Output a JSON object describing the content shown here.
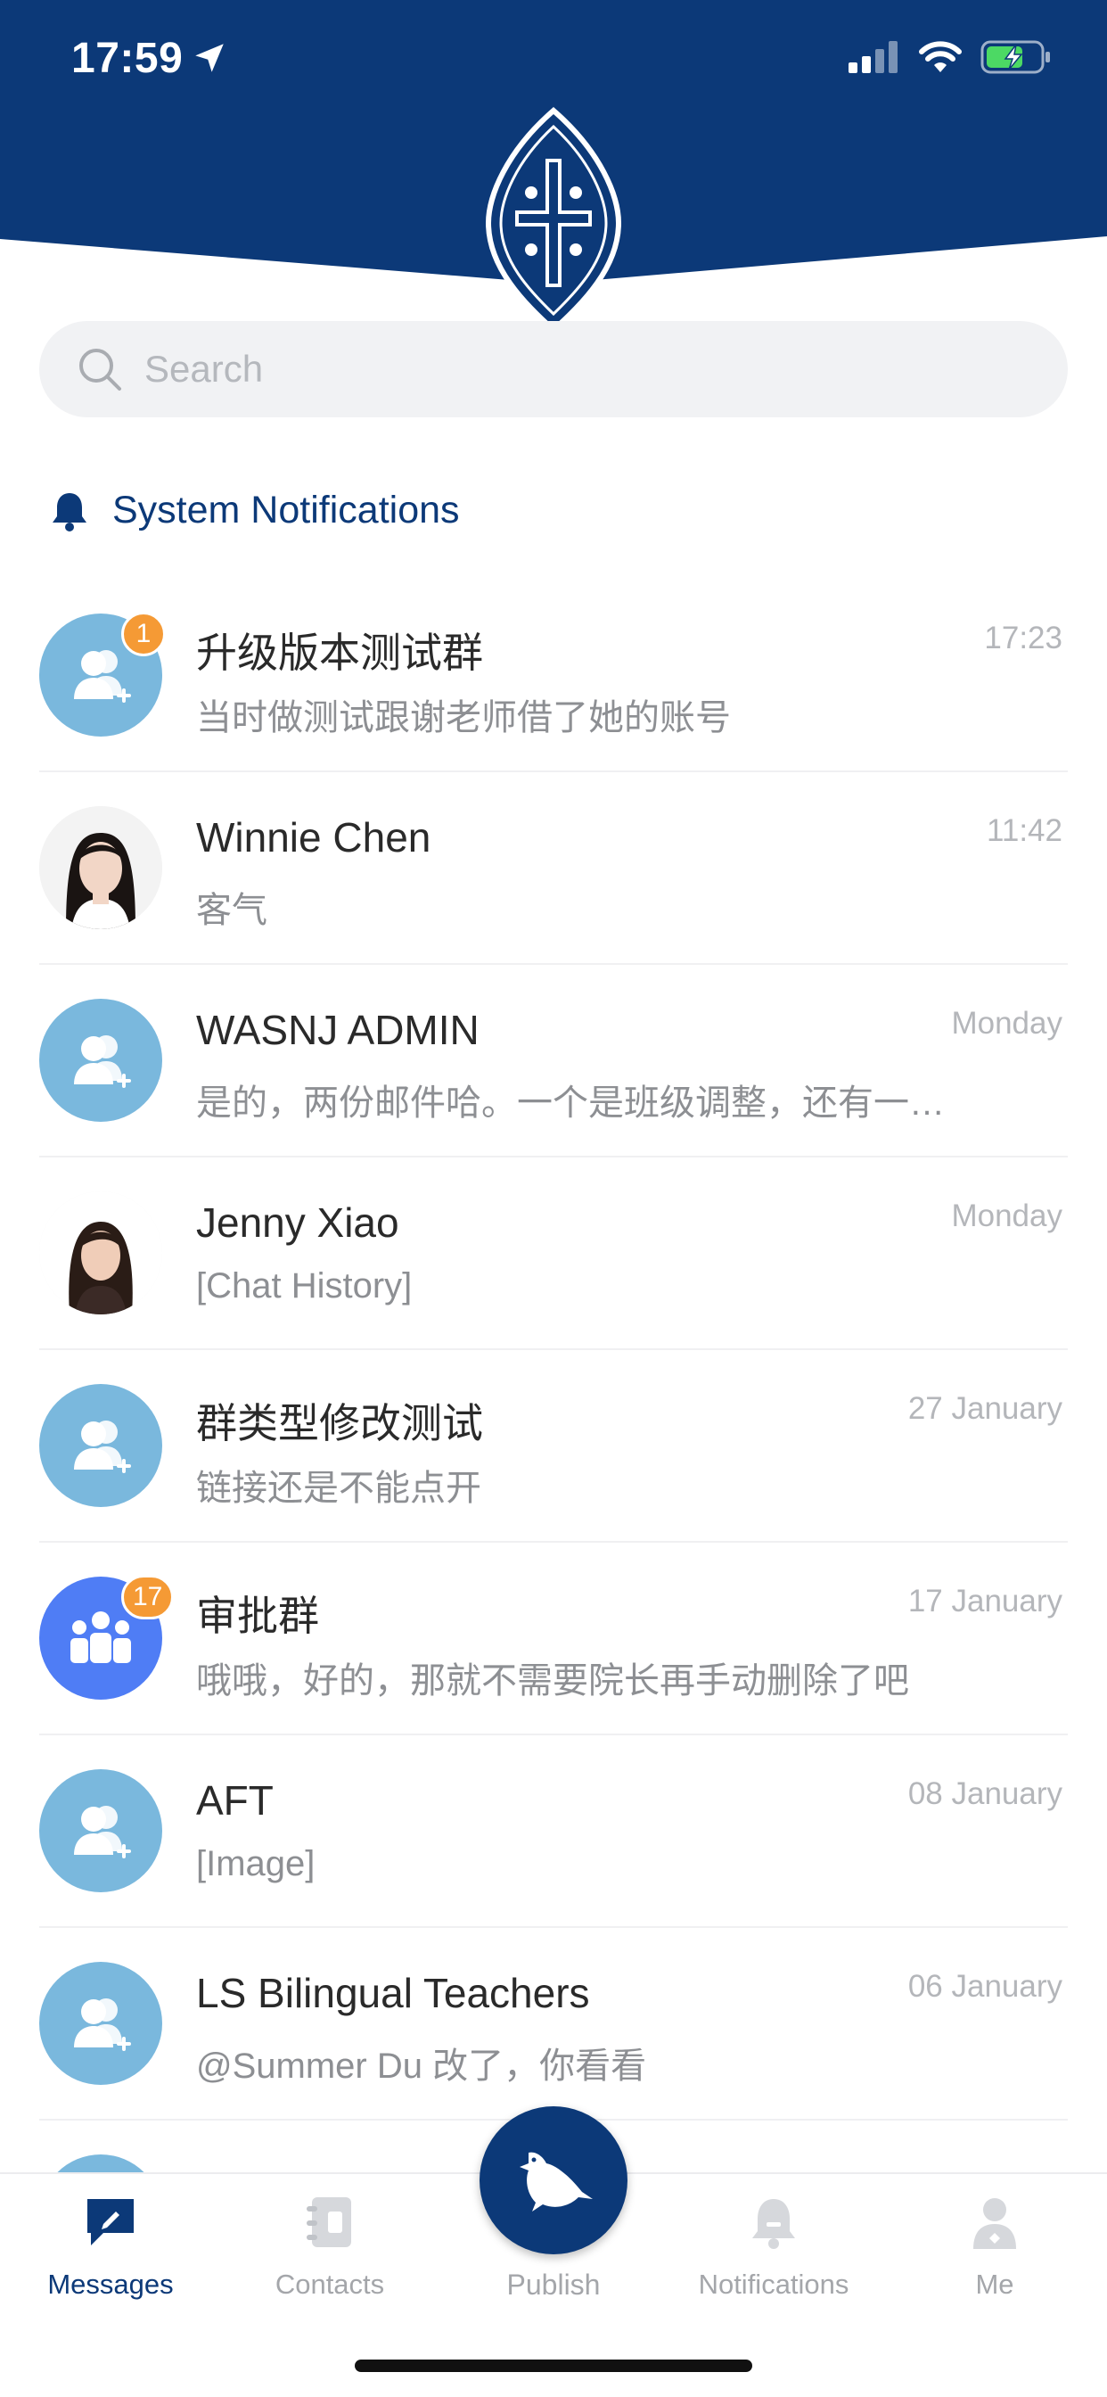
{
  "status_bar": {
    "time": "17:59"
  },
  "search": {
    "placeholder": "Search"
  },
  "system_notifications": {
    "label": "System Notifications"
  },
  "chats": [
    {
      "name": "升级版本测试群",
      "preview": "当时做测试跟谢老师借了她的账号",
      "time": "17:23",
      "badge": "1",
      "avatar": "group-light"
    },
    {
      "name": "Winnie Chen",
      "preview": "客气",
      "time": "11:42",
      "badge": "",
      "avatar": "photo"
    },
    {
      "name": "WASNJ ADMIN",
      "preview": "是的，两份邮件哈。一个是班级调整，还有一…",
      "time": "Monday",
      "badge": "",
      "avatar": "group-light"
    },
    {
      "name": "Jenny Xiao",
      "preview": "[Chat History]",
      "time": "Monday",
      "badge": "",
      "avatar": "photo"
    },
    {
      "name": "群类型修改测试",
      "preview": " 链接还是不能点开",
      "time": "27 January",
      "badge": "",
      "avatar": "group-light"
    },
    {
      "name": "审批群",
      "preview": "哦哦，好的，那就不需要院长再手动删除了吧",
      "time": "17 January",
      "badge": "17",
      "avatar": "group-blue"
    },
    {
      "name": "AFT",
      "preview": "[Image]",
      "time": "08 January",
      "badge": "",
      "avatar": "group-light"
    },
    {
      "name": "LS Bilingual Teachers",
      "preview": "@Summer Du 改了，你看看",
      "time": "06 January",
      "badge": "",
      "avatar": "group-light"
    }
  ],
  "tabs": [
    {
      "label": "Messages",
      "icon": "chat-bubble-pen-icon",
      "active": true
    },
    {
      "label": "Contacts",
      "icon": "address-book-icon",
      "active": false
    },
    {
      "label": "Publish",
      "icon": "bird-icon",
      "active": false
    },
    {
      "label": "Notifications",
      "icon": "bell-icon",
      "active": false
    },
    {
      "label": "Me",
      "icon": "person-icon",
      "active": false
    }
  ],
  "colors": {
    "brand_navy": "#0c3978",
    "badge_orange": "#f59a35",
    "group_avatar": "#7ab8dd",
    "group_avatar_blue": "#4f7df5",
    "battery_green": "#4cd964"
  }
}
